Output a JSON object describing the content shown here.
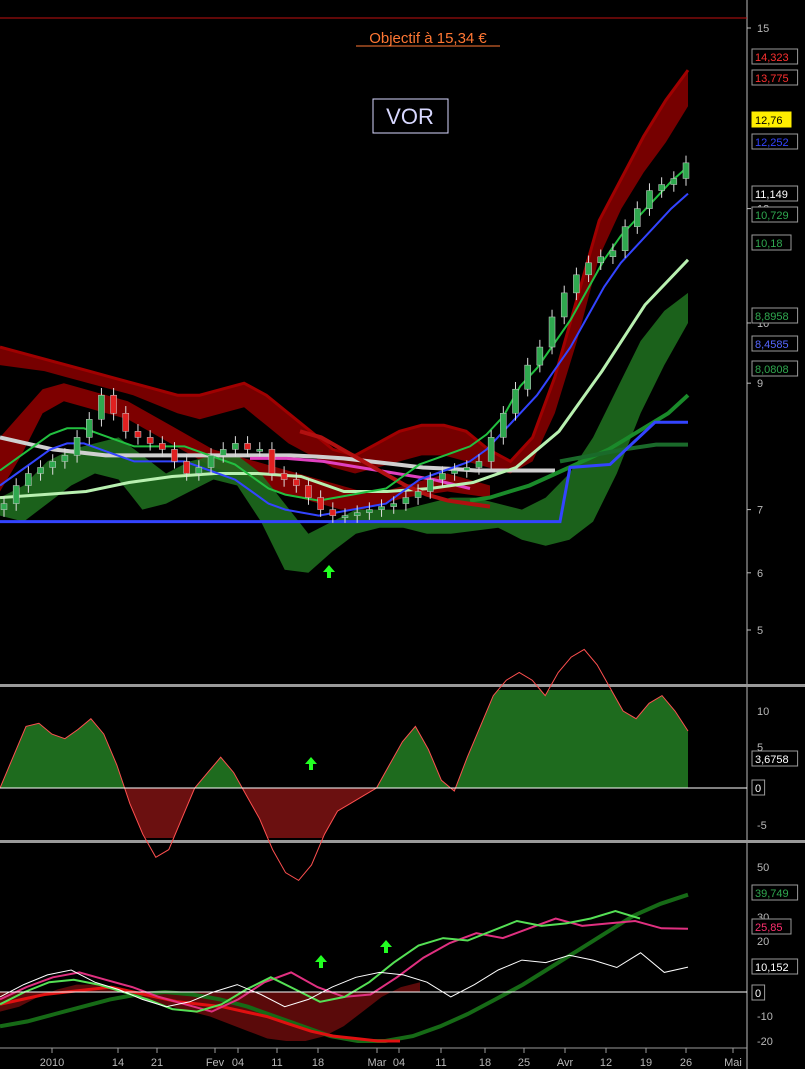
{
  "annotation": {
    "title": "Objectif à 15,34 €",
    "symbol": "VOR"
  },
  "colors": {
    "up_candle": "#2fa84f",
    "down_candle": "#e02020",
    "ma_blue": "#3344ff",
    "ma_gray": "#cfcfcf",
    "band_red": "#8b0000",
    "band_green": "#1e6b1e"
  },
  "chart_data": [
    {
      "type": "line",
      "panel": "price",
      "ylim": [
        4.0,
        15.3
      ],
      "yticks": [
        "15",
        "12",
        "10",
        "9",
        "7",
        "6",
        "5"
      ],
      "x_ticks": [
        "2010",
        "14",
        "21",
        "Fev",
        "04",
        "11",
        "18",
        "Mar",
        "04",
        "11",
        "18",
        "25",
        "Avr",
        "12",
        "19",
        "26",
        "Mai"
      ],
      "last_values": [
        {
          "value": "14,323",
          "color": "#ff3030"
        },
        {
          "value": "13,775",
          "color": "#ff3030"
        },
        {
          "value": "12,76",
          "color": "#000000",
          "bg": "#ffee00"
        },
        {
          "value": "12,252",
          "color": "#3344ff"
        },
        {
          "value": "11,149",
          "color": "#ffffff"
        },
        {
          "value": "10,729",
          "color": "#2fa84f"
        },
        {
          "value": "10,18",
          "color": "#2fa84f"
        },
        {
          "value": "8,8958",
          "color": "#2fa84f"
        },
        {
          "value": "8,4585",
          "color": "#5566ff"
        },
        {
          "value": "8,0808",
          "color": "#2fa84f"
        }
      ],
      "close_series": [
        7.1,
        7.4,
        7.6,
        7.7,
        7.8,
        7.9,
        8.2,
        8.5,
        8.9,
        8.6,
        8.3,
        8.2,
        8.1,
        8.0,
        7.8,
        7.6,
        7.7,
        7.9,
        8.0,
        8.1,
        8.0,
        8.0,
        7.6,
        7.5,
        7.4,
        7.2,
        7.0,
        6.9,
        6.9,
        6.95,
        7.0,
        7.05,
        7.1,
        7.2,
        7.3,
        7.5,
        7.6,
        7.65,
        7.7,
        7.8,
        8.2,
        8.6,
        9.0,
        9.4,
        9.7,
        10.2,
        10.6,
        10.9,
        11.1,
        11.2,
        11.3,
        11.7,
        12.0,
        12.3,
        12.4,
        12.5,
        12.76
      ],
      "ma_blue": [
        7.4,
        7.6,
        7.8,
        8.0,
        8.1,
        8.1,
        8.0,
        7.9,
        7.8,
        7.8,
        7.8,
        7.8,
        7.7,
        7.6,
        7.5,
        7.3,
        7.1,
        7.0,
        6.95,
        6.9,
        6.95,
        7.0,
        7.05,
        7.1,
        7.3,
        7.5,
        7.6,
        7.7,
        7.8,
        8.0,
        8.3,
        8.6,
        8.9,
        9.3,
        9.7,
        10.2,
        10.7,
        11.1,
        11.4,
        11.7,
        12.0,
        12.25
      ],
      "ma_gray": [
        8.2,
        8.1,
        8.0,
        7.95,
        7.9,
        7.9,
        7.9,
        7.9,
        7.9,
        7.9,
        7.9,
        7.9,
        7.88,
        7.85,
        7.8,
        7.75,
        7.7,
        7.68,
        7.65,
        7.65,
        7.65,
        7.65
      ],
      "ma_green_thick": [
        7.15,
        7.2,
        7.3,
        7.4,
        7.55,
        7.7,
        7.85,
        8.0,
        8.2,
        8.4,
        8.6,
        8.9
      ],
      "support_line": [
        6.8,
        6.8,
        6.8,
        6.8,
        6.8,
        6.8,
        6.8,
        6.8,
        6.8,
        6.8,
        6.8,
        7.8,
        8.45,
        8.45
      ]
    },
    {
      "type": "area",
      "panel": "oscillator",
      "ylim": [
        -7,
        12
      ],
      "yticks": [
        "10",
        "5",
        "0",
        "-5"
      ],
      "last_value": "3,6758",
      "zero_label": "0",
      "values": [
        0,
        2,
        4,
        4.2,
        3.5,
        3.2,
        3.8,
        4.5,
        3.5,
        1.5,
        -1,
        -3,
        -4.5,
        -4,
        -2,
        0,
        1,
        2,
        1,
        -0.5,
        -2,
        -4,
        -5.5,
        -6,
        -5,
        -3,
        -1.5,
        -1,
        -0.5,
        0,
        1.5,
        3,
        4,
        2.5,
        0.5,
        -0.2,
        2,
        4,
        6,
        7,
        7.5,
        7,
        6,
        7.5,
        8.5,
        9,
        8,
        6.5,
        5,
        4.5,
        5.5,
        6,
        5,
        3.7
      ]
    },
    {
      "type": "line",
      "panel": "stochastic",
      "ylim": [
        -25,
        57
      ],
      "yticks": [
        "50",
        "30",
        "20",
        "10",
        "0",
        "-10",
        "-20"
      ],
      "last_values": [
        {
          "value": "39,749",
          "color": "#2fa84f"
        },
        {
          "value": "25,85",
          "color": "#ff3070"
        },
        {
          "value": "10,152",
          "color": "#ffffff"
        }
      ],
      "zero_label": "0"
    }
  ]
}
